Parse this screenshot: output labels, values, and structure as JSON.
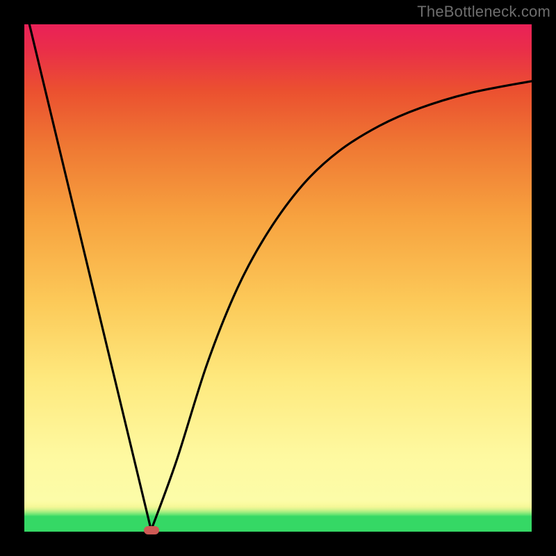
{
  "watermark": "TheBottleneck.com",
  "colors": {
    "black": "#000000",
    "gradient_top": "#ea2158",
    "gradient_bottom": "#35d865",
    "marker": "#ce5a55",
    "watermark": "#6e6e6e"
  },
  "chart_data": {
    "type": "line",
    "title": "",
    "xlabel": "",
    "ylabel": "",
    "xlim": [
      0,
      100
    ],
    "ylim": [
      0,
      100
    ],
    "grid": false,
    "legend": false,
    "notes": "V-shaped curve (absolute-bottleneck style); left branch nearly straight, right branch rises with decreasing slope. Axis units not shown; values estimated from geometry.",
    "series": [
      {
        "name": "left-branch",
        "x": [
          1.0,
          25.0
        ],
        "y": [
          100.0,
          0.3
        ]
      },
      {
        "name": "right-branch",
        "x": [
          25.0,
          30.0,
          36.0,
          42.0,
          48.0,
          55.0,
          62.0,
          70.0,
          78.0,
          88.0,
          100.0
        ],
        "y": [
          0.3,
          14.0,
          33.0,
          48.0,
          59.0,
          68.5,
          75.0,
          80.0,
          83.5,
          86.5,
          88.8
        ]
      }
    ],
    "annotations": [
      {
        "name": "min-marker",
        "x": 25.0,
        "y": 0.3
      }
    ]
  }
}
